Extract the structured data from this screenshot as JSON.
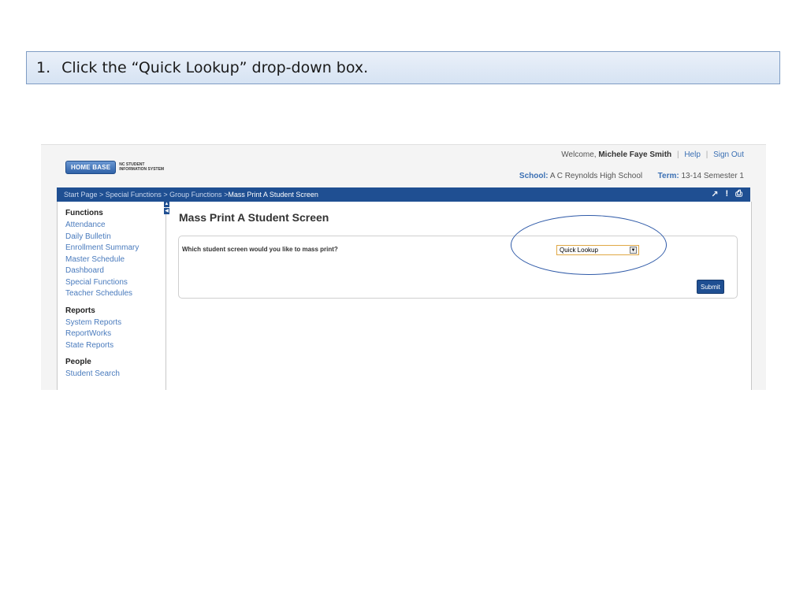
{
  "instruction": {
    "number": "1.",
    "text": "Click the “Quick Lookup” drop-down box."
  },
  "header": {
    "logo_brand": "HOME BASE",
    "logo_line1": "NC STUDENT",
    "logo_line2": "INFORMATION SYSTEM",
    "welcome_prefix": "Welcome,",
    "user_name": "Michele Faye Smith",
    "help_link": "Help",
    "signout_link": "Sign Out",
    "school_label": "School:",
    "school_value": "A C Reynolds High School",
    "term_label": "Term:",
    "term_value": "13-14 Semester 1"
  },
  "breadcrumb": {
    "path": "Start Page > Special Functions > Group Functions > ",
    "current": "Mass Print A Student Screen",
    "icons": [
      "link-icon",
      "alert-icon",
      "print-icon"
    ]
  },
  "sidebar": {
    "groups": [
      {
        "heading": "Functions",
        "items": [
          "Attendance",
          "Daily Bulletin",
          "Enrollment Summary",
          "Master Schedule",
          "Dashboard",
          "Special Functions",
          "Teacher Schedules"
        ]
      },
      {
        "heading": "Reports",
        "items": [
          "System Reports",
          "ReportWorks",
          "State Reports"
        ]
      },
      {
        "heading": "People",
        "items": [
          "Student Search"
        ]
      }
    ]
  },
  "main": {
    "title": "Mass Print A Student Screen",
    "question": "Which student screen would you like to mass print?",
    "select_value": "Quick Lookup",
    "submit_label": "Submit"
  },
  "colors": {
    "nav_blue": "#1f4f92",
    "link_blue": "#4a7bbd",
    "select_border": "#e0a845"
  }
}
